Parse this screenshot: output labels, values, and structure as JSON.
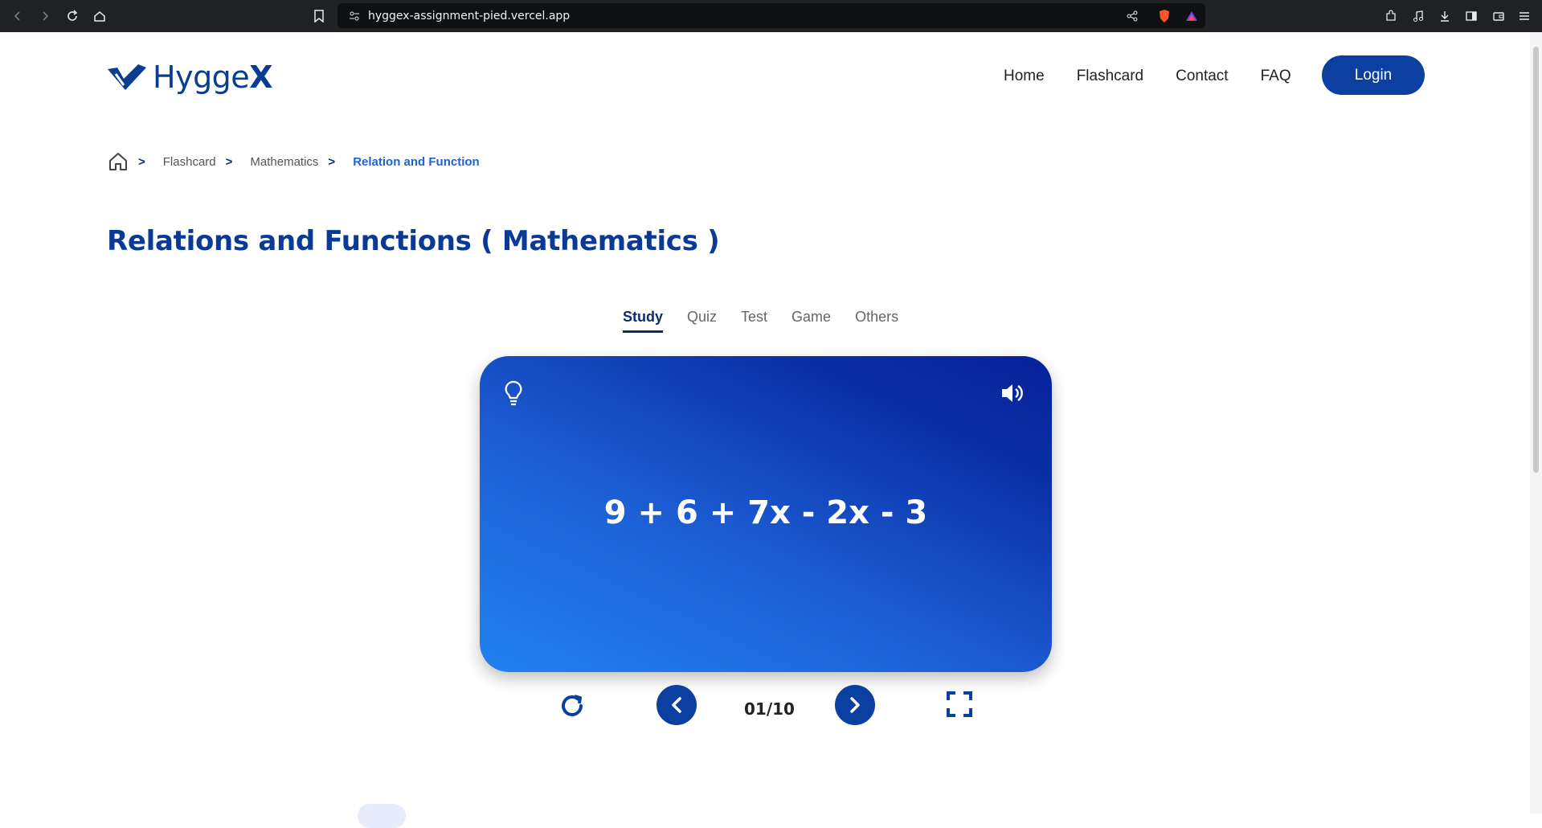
{
  "browser": {
    "url": "hyggex-assignment-pied.vercel.app"
  },
  "header": {
    "logo_text_main": "Hygge",
    "logo_text_x": "X",
    "nav": [
      "Home",
      "Flashcard",
      "Contact",
      "FAQ"
    ],
    "login_label": "Login"
  },
  "breadcrumb": {
    "items": [
      "Flashcard",
      "Mathematics"
    ],
    "current": "Relation and Function",
    "separator": ">"
  },
  "page_title": "Relations and Functions ( Mathematics )",
  "tabs": {
    "items": [
      "Study",
      "Quiz",
      "Test",
      "Game",
      "Others"
    ],
    "active": "Study"
  },
  "card": {
    "question": "9 + 6 + 7x - 2x - 3",
    "colors": {
      "start": "#2282f0",
      "end": "#06229a"
    }
  },
  "controls": {
    "counter": "01/10"
  },
  "colors": {
    "brand": "#0b3fa0",
    "title": "#0b3a96",
    "breadcrumb_active": "#1d63d8"
  }
}
